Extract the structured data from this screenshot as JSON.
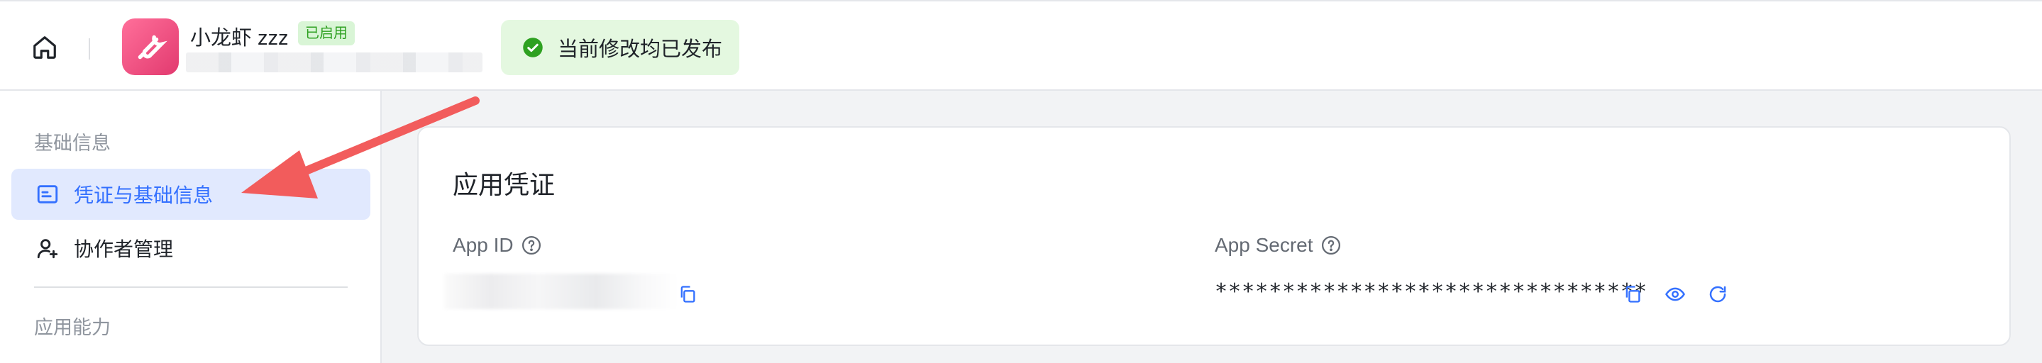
{
  "header": {
    "app_name": "小龙虾 zzz",
    "status_badge": "已启用",
    "toast": "当前修改均已发布"
  },
  "sidebar": {
    "sections": [
      {
        "title": "基础信息"
      },
      {
        "title": "应用能力"
      }
    ],
    "items": [
      {
        "label": "凭证与基础信息",
        "active": true
      },
      {
        "label": "协作者管理",
        "active": false
      }
    ]
  },
  "credentials": {
    "title": "应用凭证",
    "app_id_label": "App ID",
    "app_secret_label": "App Secret",
    "app_secret_masked": "********************************"
  },
  "colors": {
    "accent": "#3370ff",
    "success": "#2ea121",
    "annotation_arrow": "#f25c5c"
  }
}
